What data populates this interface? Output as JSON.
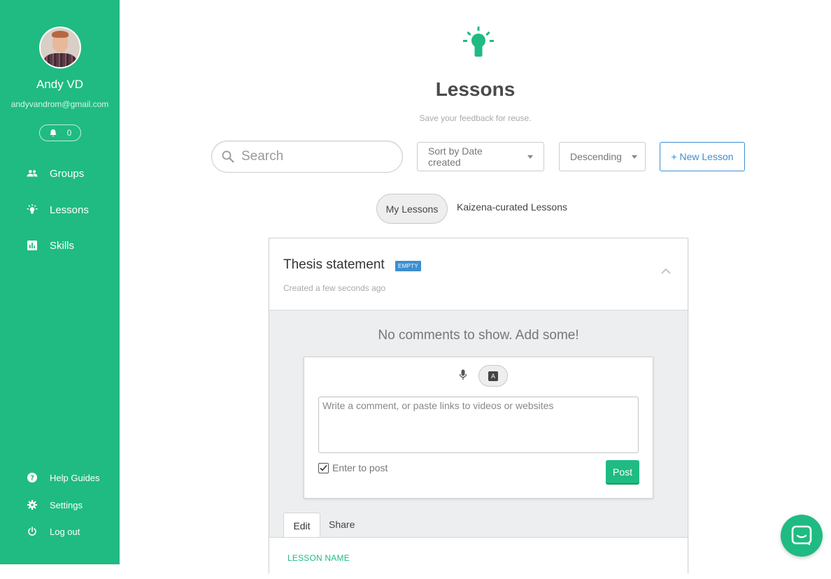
{
  "sidebar": {
    "user_name": "Andy VD",
    "user_email": "andyvandrom@gmail.com",
    "notifications_count": "0",
    "nav": [
      {
        "label": "Groups",
        "icon": "groups-icon"
      },
      {
        "label": "Lessons",
        "icon": "lightbulb-icon"
      },
      {
        "label": "Skills",
        "icon": "skills-chart-icon"
      }
    ],
    "bottom_nav": [
      {
        "label": "Help Guides",
        "icon": "help-icon"
      },
      {
        "label": "Settings",
        "icon": "gear-icon"
      },
      {
        "label": "Log out",
        "icon": "power-icon"
      }
    ]
  },
  "header": {
    "title": "Lessons",
    "subtitle": "Save your feedback for reuse."
  },
  "toolbar": {
    "search_placeholder": "Search",
    "sort_label": "Sort by Date created",
    "order_label": "Descending",
    "new_lesson_label": "+ New Lesson"
  },
  "filter_tabs": {
    "mine": "My Lessons",
    "kaizena": "Kaizena-curated Lessons"
  },
  "lesson": {
    "title": "Thesis statement",
    "badge": "EMPTY",
    "created": "Created a few seconds ago",
    "no_comments": "No comments to show. Add some!",
    "comment_placeholder": "Write a comment, or paste links to videos or websites",
    "text_mode_letter": "A",
    "enter_to_post_label": "Enter to post",
    "enter_to_post_checked": true,
    "post_label": "Post",
    "tabs": {
      "edit": "Edit",
      "share": "Share"
    },
    "lesson_name_label": "LESSON NAME"
  },
  "colors": {
    "brand": "#1fbb83",
    "accent_blue": "#3e8ed0"
  }
}
